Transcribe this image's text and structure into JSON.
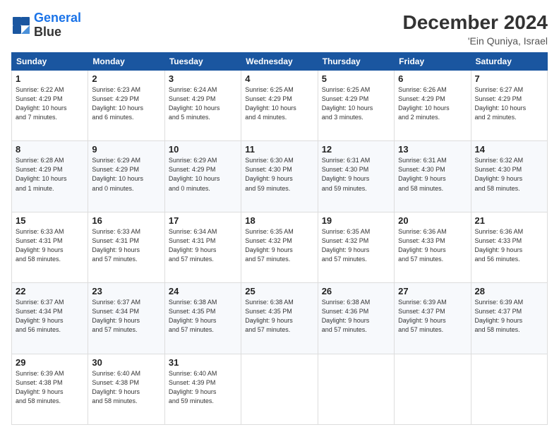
{
  "header": {
    "logo_line1": "General",
    "logo_line2": "Blue",
    "month": "December 2024",
    "location": "'Ein Quniya, Israel"
  },
  "days_of_week": [
    "Sunday",
    "Monday",
    "Tuesday",
    "Wednesday",
    "Thursday",
    "Friday",
    "Saturday"
  ],
  "weeks": [
    [
      {
        "day": "1",
        "text": "Sunrise: 6:22 AM\nSunset: 4:29 PM\nDaylight: 10 hours\nand 7 minutes."
      },
      {
        "day": "2",
        "text": "Sunrise: 6:23 AM\nSunset: 4:29 PM\nDaylight: 10 hours\nand 6 minutes."
      },
      {
        "day": "3",
        "text": "Sunrise: 6:24 AM\nSunset: 4:29 PM\nDaylight: 10 hours\nand 5 minutes."
      },
      {
        "day": "4",
        "text": "Sunrise: 6:25 AM\nSunset: 4:29 PM\nDaylight: 10 hours\nand 4 minutes."
      },
      {
        "day": "5",
        "text": "Sunrise: 6:25 AM\nSunset: 4:29 PM\nDaylight: 10 hours\nand 3 minutes."
      },
      {
        "day": "6",
        "text": "Sunrise: 6:26 AM\nSunset: 4:29 PM\nDaylight: 10 hours\nand 2 minutes."
      },
      {
        "day": "7",
        "text": "Sunrise: 6:27 AM\nSunset: 4:29 PM\nDaylight: 10 hours\nand 2 minutes."
      }
    ],
    [
      {
        "day": "8",
        "text": "Sunrise: 6:28 AM\nSunset: 4:29 PM\nDaylight: 10 hours\nand 1 minute."
      },
      {
        "day": "9",
        "text": "Sunrise: 6:29 AM\nSunset: 4:29 PM\nDaylight: 10 hours\nand 0 minutes."
      },
      {
        "day": "10",
        "text": "Sunrise: 6:29 AM\nSunset: 4:29 PM\nDaylight: 10 hours\nand 0 minutes."
      },
      {
        "day": "11",
        "text": "Sunrise: 6:30 AM\nSunset: 4:30 PM\nDaylight: 9 hours\nand 59 minutes."
      },
      {
        "day": "12",
        "text": "Sunrise: 6:31 AM\nSunset: 4:30 PM\nDaylight: 9 hours\nand 59 minutes."
      },
      {
        "day": "13",
        "text": "Sunrise: 6:31 AM\nSunset: 4:30 PM\nDaylight: 9 hours\nand 58 minutes."
      },
      {
        "day": "14",
        "text": "Sunrise: 6:32 AM\nSunset: 4:30 PM\nDaylight: 9 hours\nand 58 minutes."
      }
    ],
    [
      {
        "day": "15",
        "text": "Sunrise: 6:33 AM\nSunset: 4:31 PM\nDaylight: 9 hours\nand 58 minutes."
      },
      {
        "day": "16",
        "text": "Sunrise: 6:33 AM\nSunset: 4:31 PM\nDaylight: 9 hours\nand 57 minutes."
      },
      {
        "day": "17",
        "text": "Sunrise: 6:34 AM\nSunset: 4:31 PM\nDaylight: 9 hours\nand 57 minutes."
      },
      {
        "day": "18",
        "text": "Sunrise: 6:35 AM\nSunset: 4:32 PM\nDaylight: 9 hours\nand 57 minutes."
      },
      {
        "day": "19",
        "text": "Sunrise: 6:35 AM\nSunset: 4:32 PM\nDaylight: 9 hours\nand 57 minutes."
      },
      {
        "day": "20",
        "text": "Sunrise: 6:36 AM\nSunset: 4:33 PM\nDaylight: 9 hours\nand 57 minutes."
      },
      {
        "day": "21",
        "text": "Sunrise: 6:36 AM\nSunset: 4:33 PM\nDaylight: 9 hours\nand 56 minutes."
      }
    ],
    [
      {
        "day": "22",
        "text": "Sunrise: 6:37 AM\nSunset: 4:34 PM\nDaylight: 9 hours\nand 56 minutes."
      },
      {
        "day": "23",
        "text": "Sunrise: 6:37 AM\nSunset: 4:34 PM\nDaylight: 9 hours\nand 57 minutes."
      },
      {
        "day": "24",
        "text": "Sunrise: 6:38 AM\nSunset: 4:35 PM\nDaylight: 9 hours\nand 57 minutes."
      },
      {
        "day": "25",
        "text": "Sunrise: 6:38 AM\nSunset: 4:35 PM\nDaylight: 9 hours\nand 57 minutes."
      },
      {
        "day": "26",
        "text": "Sunrise: 6:38 AM\nSunset: 4:36 PM\nDaylight: 9 hours\nand 57 minutes."
      },
      {
        "day": "27",
        "text": "Sunrise: 6:39 AM\nSunset: 4:37 PM\nDaylight: 9 hours\nand 57 minutes."
      },
      {
        "day": "28",
        "text": "Sunrise: 6:39 AM\nSunset: 4:37 PM\nDaylight: 9 hours\nand 58 minutes."
      }
    ],
    [
      {
        "day": "29",
        "text": "Sunrise: 6:39 AM\nSunset: 4:38 PM\nDaylight: 9 hours\nand 58 minutes."
      },
      {
        "day": "30",
        "text": "Sunrise: 6:40 AM\nSunset: 4:38 PM\nDaylight: 9 hours\nand 58 minutes."
      },
      {
        "day": "31",
        "text": "Sunrise: 6:40 AM\nSunset: 4:39 PM\nDaylight: 9 hours\nand 59 minutes."
      },
      {
        "day": "",
        "text": ""
      },
      {
        "day": "",
        "text": ""
      },
      {
        "day": "",
        "text": ""
      },
      {
        "day": "",
        "text": ""
      }
    ]
  ]
}
